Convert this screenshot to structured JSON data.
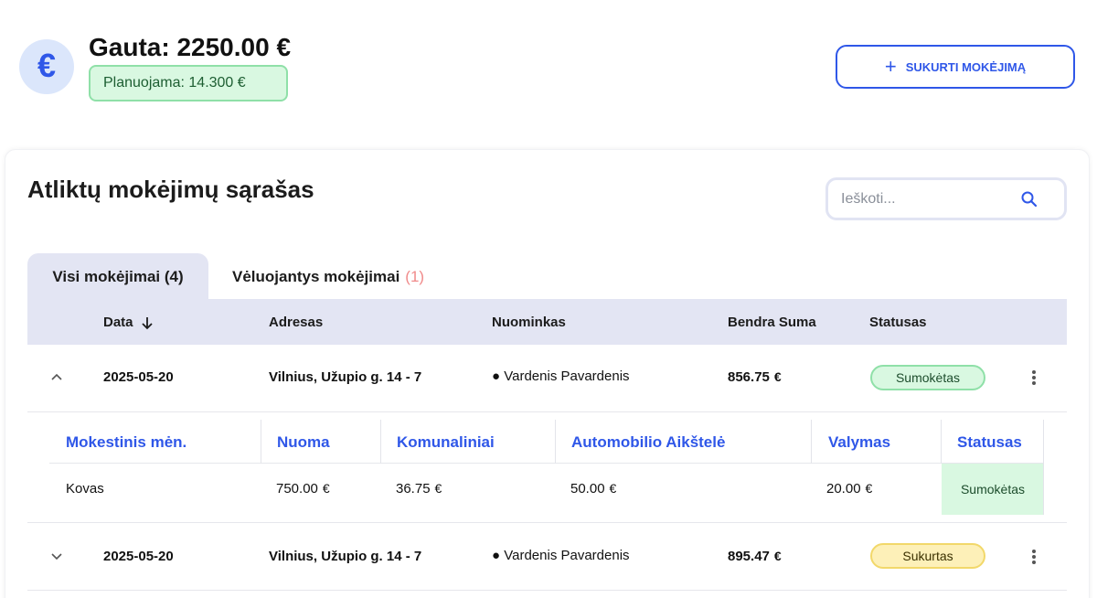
{
  "header": {
    "received": "Gauta: 2250.00 €",
    "planned": "Planuojama: 14.300 €",
    "create_button": "SUKURTI MOKĖJIMĄ",
    "euro_symbol": "€"
  },
  "card": {
    "title": "Atliktų mokėjimų sąrašas",
    "search_placeholder": "Ieškoti..."
  },
  "tabs": [
    {
      "label": "Visi mokėjimai (4)",
      "active": true
    },
    {
      "label": "Vėluojantys mokėjimai",
      "count": "(1)",
      "active": false
    }
  ],
  "table": {
    "columns": [
      "Data",
      "Adresas",
      "Nuominkas",
      "Bendra Suma",
      "Statusas"
    ],
    "rows": [
      {
        "date": "2025-05-20",
        "address": "Vilnius, Užupio g. 14 - 7",
        "tenant": "● Vardenis Pavardenis",
        "total": "856.75",
        "currency": "€",
        "status": "Sumokėtas",
        "expanded": true
      },
      {
        "date": "2025-05-20",
        "address": "Vilnius, Užupio g. 14 - 7",
        "tenant": "● Vardenis Pavardenis",
        "total": "895.47",
        "currency": "€",
        "status": "Sukurtas",
        "expanded": false
      }
    ]
  },
  "subtable": {
    "columns": [
      "Mokestinis mėn.",
      "Nuoma",
      "Komunaliniai",
      "Automobilio Aikštelė",
      "Valymas",
      "Statusas"
    ],
    "row": {
      "month": "Kovas",
      "rent": "750.00",
      "utilities": "36.75",
      "parking": "50.00",
      "cleaning": "20.00",
      "currency": "€",
      "status": "Sumokėtas"
    }
  },
  "colors": {
    "accent": "#2f57e8",
    "paid_bg": "#d9f8e1",
    "created_bg": "#fdf0b8",
    "header_bg": "#e3e5f3",
    "late_count": "#f08a8a"
  }
}
